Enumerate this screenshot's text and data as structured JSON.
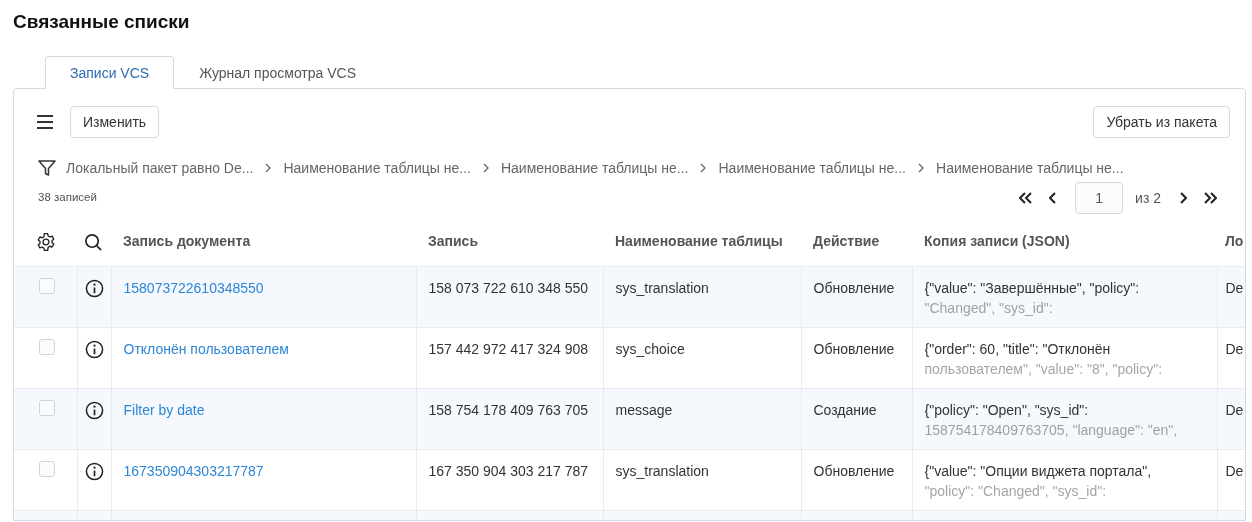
{
  "page_title": "Связанные списки",
  "tabs": [
    {
      "label": "Записи VCS",
      "selected": true
    },
    {
      "label": "Журнал просмотра VCS",
      "selected": false
    }
  ],
  "toolbar": {
    "edit_button": "Изменить",
    "remove_button": "Убрать из пакета"
  },
  "filter": [
    "Локальный пакет равно De...",
    "Наименование таблицы не...",
    "Наименование таблицы не...",
    "Наименование таблицы не...",
    "Наименование таблицы не..."
  ],
  "record_count": "38 записей",
  "pager": {
    "page": "1",
    "of": "из 2"
  },
  "table": {
    "columns": [
      "Запись документа",
      "Запись",
      "Наименование таблицы",
      "Действие",
      "Копия записи (JSON)",
      "Ло"
    ],
    "rows": [
      {
        "checked": false,
        "cells": [
          "158073722610348550",
          "158 073 722 610 348 550",
          "sys_translation",
          "Обновление",
          "{\"value\": \"Завершённые\", \"policy\": \"Changed\", \"sys_id\":",
          "De"
        ]
      },
      {
        "checked": false,
        "cells": [
          "Отклонён пользователем",
          "157 442 972 417 324 908",
          "sys_choice",
          "Обновление",
          "{\"order\": 60, \"title\": \"Отклонён пользователем\", \"value\": \"8\", \"policy\":",
          "De"
        ]
      },
      {
        "checked": false,
        "cells": [
          "Filter by date",
          "158 754 178 409 763 705",
          "message",
          "Создание",
          "{\"policy\": \"Open\", \"sys_id\": 158754178409763705, \"language\": \"en\",",
          "De"
        ]
      },
      {
        "checked": false,
        "cells": [
          "167350904303217787",
          "167 350 904 303 217 787",
          "sys_translation",
          "Обновление",
          "{\"value\": \"Опции виджета портала\", \"policy\": \"Changed\", \"sys_id\":",
          "De"
        ]
      }
    ]
  }
}
